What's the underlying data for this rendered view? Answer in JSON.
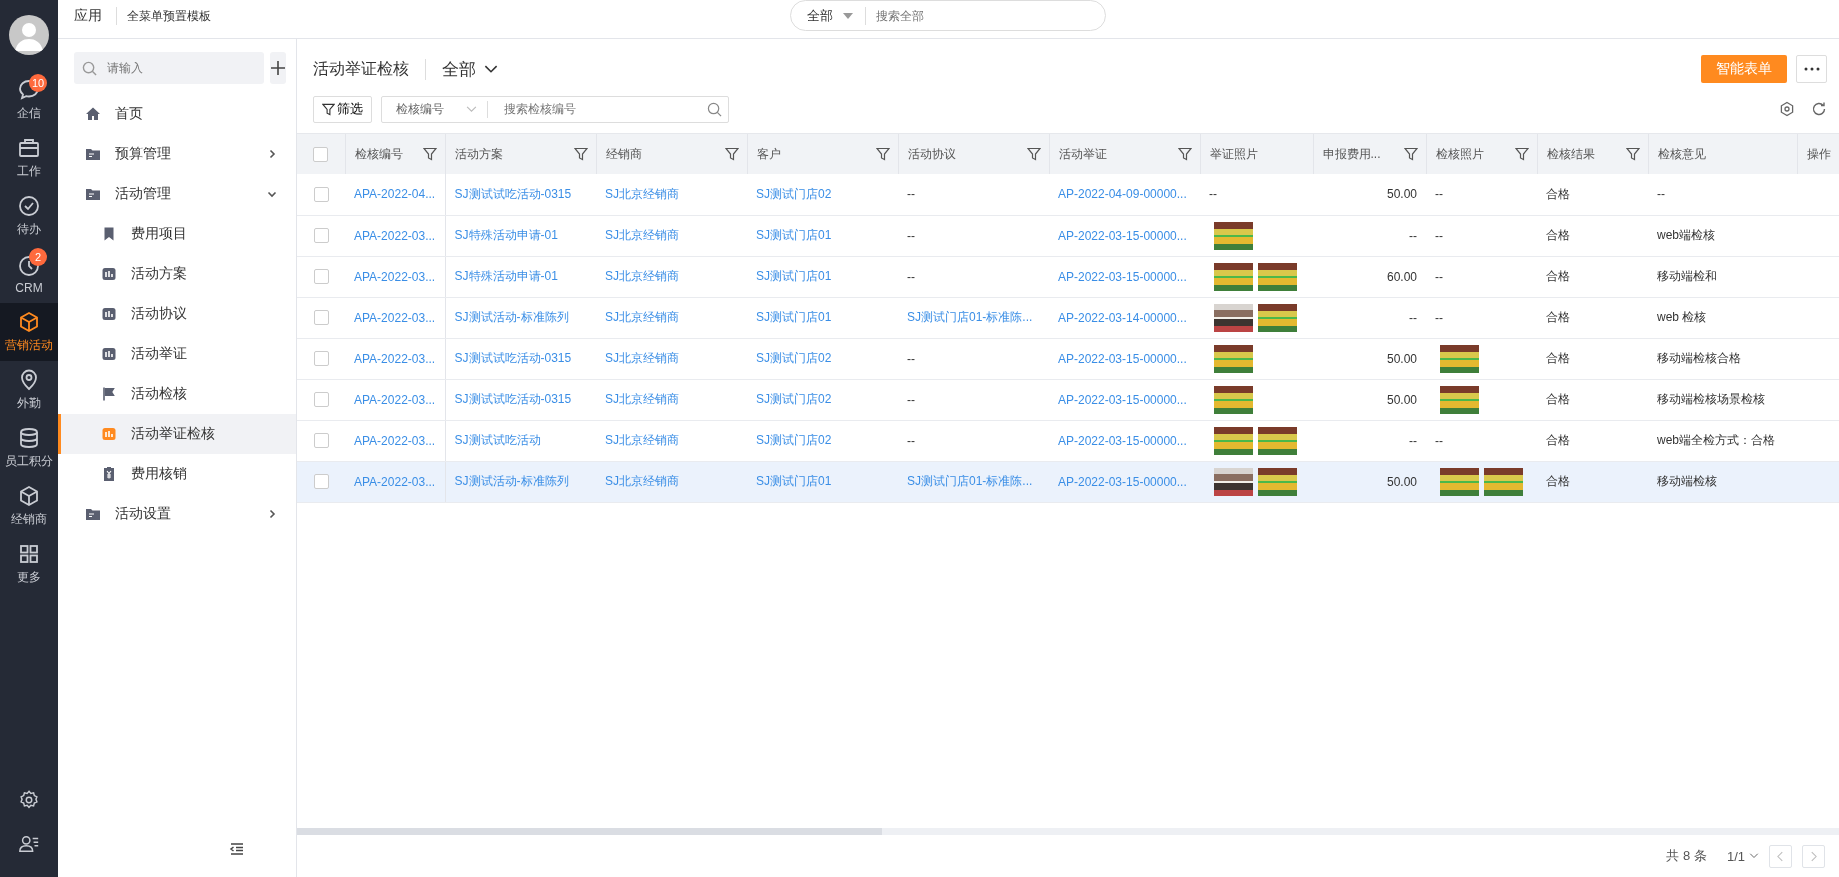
{
  "rail": {
    "items": [
      {
        "label": "企信",
        "kind": "chat",
        "badge": "10",
        "selected": false
      },
      {
        "label": "工作",
        "kind": "briefcase",
        "selected": false
      },
      {
        "label": "待办",
        "kind": "check",
        "selected": false
      },
      {
        "label": "CRM",
        "kind": "clock",
        "badge": "2",
        "selected": false
      },
      {
        "label": "营销活动",
        "kind": "cube",
        "selected": true
      },
      {
        "label": "外勤",
        "kind": "pin",
        "selected": false
      },
      {
        "label": "员工积分",
        "kind": "database",
        "selected": false
      },
      {
        "label": "经销商",
        "kind": "cube",
        "selected": false
      },
      {
        "label": "更多",
        "kind": "grid",
        "selected": false
      }
    ]
  },
  "topbar": {
    "app": "应用",
    "template": "全菜单预置模板",
    "scope": "全部",
    "search_placeholder": "搜索全部"
  },
  "sidebar": {
    "search_placeholder": "请输入",
    "items": [
      {
        "label": "首页",
        "kind": "home",
        "selected": false
      },
      {
        "label": "预算管理",
        "kind": "folder",
        "expanded": false
      },
      {
        "label": "活动管理",
        "kind": "folder",
        "expanded": true,
        "children": [
          {
            "label": "费用项目",
            "kind": "bookmark",
            "selected": false
          },
          {
            "label": "活动方案",
            "kind": "chart",
            "selected": false
          },
          {
            "label": "活动协议",
            "kind": "chart",
            "selected": false
          },
          {
            "label": "活动举证",
            "kind": "chart",
            "selected": false
          },
          {
            "label": "活动检核",
            "kind": "flag",
            "selected": false
          },
          {
            "label": "活动举证检核",
            "kind": "chart",
            "selected": true
          },
          {
            "label": "费用核销",
            "kind": "receipt",
            "selected": false
          }
        ]
      },
      {
        "label": "活动设置",
        "kind": "folder",
        "expanded": false
      }
    ]
  },
  "page": {
    "title": "活动举证检核",
    "view": "全部",
    "primary_button": "智能表单"
  },
  "toolbar": {
    "filter_button": "筛选",
    "field": "检核编号",
    "search_placeholder": "搜索检核编号"
  },
  "table": {
    "all_checked": false,
    "columns": [
      {
        "label": "检核编号",
        "kind": "link",
        "filter": true
      },
      {
        "label": "活动方案",
        "kind": "link",
        "filter": true
      },
      {
        "label": "经销商",
        "kind": "link",
        "filter": true
      },
      {
        "label": "客户",
        "kind": "link",
        "filter": true
      },
      {
        "label": "活动协议",
        "kind": "link",
        "filter": true
      },
      {
        "label": "活动举证",
        "kind": "link",
        "filter": true
      },
      {
        "label": "举证照片",
        "kind": "photos",
        "filter": false
      },
      {
        "label": "申报费用...",
        "kind": "number",
        "filter": true
      },
      {
        "label": "检核照片",
        "kind": "photos",
        "filter": true
      },
      {
        "label": "检核结果",
        "kind": "text",
        "filter": true
      },
      {
        "label": "检核意见",
        "kind": "text",
        "filter": false
      },
      {
        "label": "操作",
        "kind": "text",
        "filter": false
      }
    ],
    "rows": [
      {
        "hovered": false,
        "checked": false,
        "cells": [
          "APA-2022-04...",
          "SJ测试试吃活动-0315",
          "SJ北京经销商",
          "SJ测试门店02",
          "--",
          "AP-2022-04-09-00000...",
          "--",
          "50.00",
          "--",
          "合格",
          "--"
        ]
      },
      {
        "hovered": false,
        "checked": false,
        "cells": [
          "APA-2022-03...",
          "SJ特殊活动申请-01",
          "SJ北京经销商",
          "SJ测试门店01",
          "--",
          "AP-2022-03-15-00000...",
          [
            {
              "kind": "snack-shelf"
            }
          ],
          "--",
          "--",
          "合格",
          "web端检核"
        ]
      },
      {
        "hovered": false,
        "checked": false,
        "cells": [
          "APA-2022-03...",
          "SJ特殊活动申请-01",
          "SJ北京经销商",
          "SJ测试门店01",
          "--",
          "AP-2022-03-15-00000...",
          [
            {
              "kind": "snack-shelf"
            },
            {
              "kind": "snack-shelf"
            }
          ],
          "60.00",
          "--",
          "合格",
          "移动端检和"
        ]
      },
      {
        "hovered": false,
        "checked": false,
        "cells": [
          "APA-2022-03...",
          "SJ测试活动-标准陈列",
          "SJ北京经销商",
          "SJ测试门店01",
          "SJ测试门店01-标准陈...",
          "AP-2022-03-14-00000...",
          [
            {
              "kind": "bottle-shelf"
            },
            {
              "kind": "snack-shelf"
            }
          ],
          "--",
          "--",
          "合格",
          "web 检核"
        ]
      },
      {
        "hovered": false,
        "checked": false,
        "cells": [
          "APA-2022-03...",
          "SJ测试试吃活动-0315",
          "SJ北京经销商",
          "SJ测试门店02",
          "--",
          "AP-2022-03-15-00000...",
          [
            {
              "kind": "snack-shelf"
            }
          ],
          "50.00",
          [
            {
              "kind": "snack-shelf"
            }
          ],
          "合格",
          "移动端检核合格"
        ]
      },
      {
        "hovered": false,
        "checked": false,
        "cells": [
          "APA-2022-03...",
          "SJ测试试吃活动-0315",
          "SJ北京经销商",
          "SJ测试门店02",
          "--",
          "AP-2022-03-15-00000...",
          [
            {
              "kind": "snack-shelf"
            }
          ],
          "50.00",
          [
            {
              "kind": "snack-shelf"
            }
          ],
          "合格",
          "移动端检核场景检核"
        ]
      },
      {
        "hovered": false,
        "checked": false,
        "cells": [
          "APA-2022-03...",
          "SJ测试试吃活动",
          "SJ北京经销商",
          "SJ测试门店02",
          "--",
          "AP-2022-03-15-00000...",
          [
            {
              "kind": "snack-shelf"
            },
            {
              "kind": "snack-shelf"
            }
          ],
          "--",
          "--",
          "合格",
          "web端全检方式：合格"
        ]
      },
      {
        "hovered": true,
        "checked": false,
        "cells": [
          "APA-2022-03...",
          "SJ测试活动-标准陈列",
          "SJ北京经销商",
          "SJ测试门店01",
          "SJ测试门店01-标准陈...",
          "AP-2022-03-15-00000...",
          [
            {
              "kind": "bottle-shelf"
            },
            {
              "kind": "snack-shelf"
            }
          ],
          "50.00",
          [
            {
              "kind": "snack-shelf"
            },
            {
              "kind": "snack-shelf"
            }
          ],
          "合格",
          "移动端检核"
        ]
      }
    ]
  },
  "footer": {
    "total": "共 8 条",
    "page": "1/1"
  }
}
